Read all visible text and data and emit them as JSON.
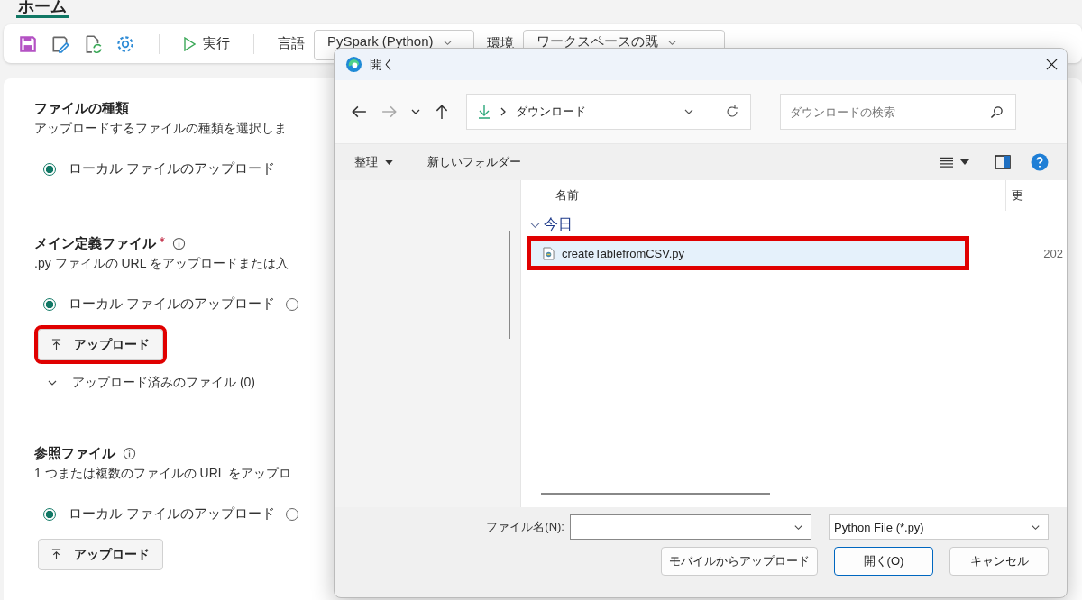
{
  "tab": {
    "label": "ホーム",
    "selected": true
  },
  "toolbar": {
    "run_label": "実行",
    "language_label": "言語",
    "language_value": "PySpark (Python)",
    "environment_label": "環境",
    "environment_value": "ワークスペースの既"
  },
  "sections": [
    {
      "title": "ファイルの種類",
      "required": false,
      "info": false,
      "description": "アップロードするファイルの種類を選択しま",
      "options": [
        {
          "label": "ローカル ファイルのアップロード",
          "selected": true
        }
      ]
    },
    {
      "title": "メイン定義ファイル",
      "required": true,
      "info": true,
      "description": ".py ファイルの URL をアップロードまたは入",
      "options": [
        {
          "label": "ローカル ファイルのアップロード",
          "selected": true
        },
        {
          "selected": false
        }
      ],
      "upload_button": {
        "label": "アップロード",
        "highlighted": true
      },
      "uploaded_files": {
        "label": "アップロード済みのファイル (0)",
        "expanded": false
      }
    },
    {
      "title": "参照ファイル",
      "required": false,
      "info": true,
      "description": "1 つまたは複数のファイルの URL をアップロ",
      "options": [
        {
          "label": "ローカル ファイルのアップロード",
          "selected": true
        },
        {
          "selected": false
        }
      ],
      "upload_button": {
        "label": "アップロード",
        "highlighted": false
      }
    }
  ],
  "dialog": {
    "title": "開く",
    "address": "ダウンロード",
    "search": {
      "placeholder": "ダウンロードの検索"
    },
    "commands": [
      {
        "label": "整理",
        "menu": true
      },
      {
        "label": "新しいフォルダー",
        "menu": false
      }
    ],
    "columns": [
      "名前",
      "更"
    ],
    "groups": [
      {
        "label": "今日",
        "expanded": true,
        "files": [
          {
            "name": "createTablefromCSV.py",
            "date": "202",
            "selected": true,
            "highlighted": true
          }
        ]
      }
    ],
    "filename_label": "ファイル名(N):",
    "filter": "Python File (*.py)",
    "buttons": [
      {
        "label": "モバイルからアップロード",
        "default": false
      },
      {
        "label": "開く(O)",
        "default": true
      },
      {
        "label": "キャンセル",
        "default": false
      }
    ]
  }
}
